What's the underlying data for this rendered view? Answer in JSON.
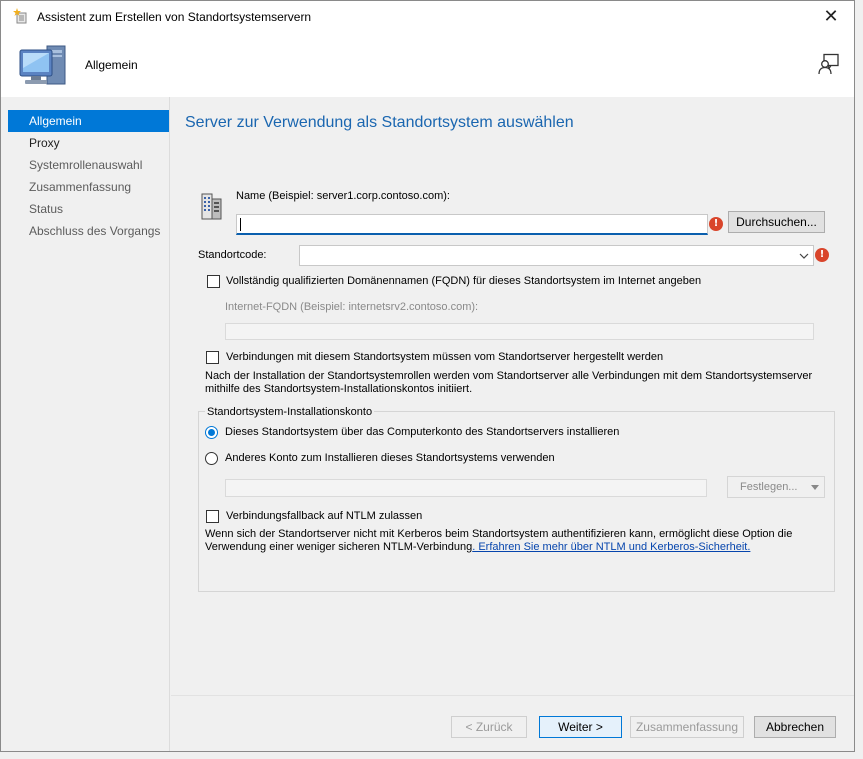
{
  "window": {
    "title": "Assistent zum Erstellen von Standortsystemservern",
    "close_glyph": "✕",
    "header_title": "Allgemein"
  },
  "sidebar": {
    "items": [
      {
        "label": "Allgemein",
        "state": "active"
      },
      {
        "label": "Proxy",
        "state": "normal"
      },
      {
        "label": "Systemrollenauswahl",
        "state": "dim"
      },
      {
        "label": "Zusammenfassung",
        "state": "dim"
      },
      {
        "label": "Status",
        "state": "dim"
      },
      {
        "label": "Abschluss des Vorgangs",
        "state": "dim"
      }
    ]
  },
  "main": {
    "heading": "Server zur Verwendung als Standortsystem auswählen",
    "name_label": "Name (Beispiel: server1.corp.contoso.com):",
    "name_value": "",
    "browse_button": "Durchsuchen...",
    "site_code_label": "Standortcode:",
    "site_code_value": "",
    "fqdn_checkbox_label": "Vollständig qualifizierten Domänennamen (FQDN) für dieses Standortsystem im Internet angeben",
    "fqdn_checked": false,
    "internet_fqdn_label": "Internet-FQDN (Beispiel: internetsrv2.contoso.com):",
    "internet_fqdn_value": "",
    "connections_checkbox_label": "Verbindungen mit diesem Standortsystem müssen vom Standortserver hergestellt werden",
    "connections_checked": false,
    "connections_note": "Nach der Installation der Standortsystemrollen werden vom Standortserver alle Verbindungen mit dem Standortsystemserver mithilfe des Standortsystem-Installationskontos initiiert.",
    "install_account_group_title": "Standortsystem-Installationskonto",
    "radio_computer_account": "Dieses Standortsystem über das Computerkonto des Standortservers installieren",
    "radio_other_account": "Anderes Konto zum Installieren dieses Standortsystems verwenden",
    "selected_radio": "computer_account",
    "account_value": "",
    "set_dropdown_label": "Festlegen...",
    "ntlm_checkbox_label": "Verbindungsfallback auf NTLM zulassen",
    "ntlm_checked": false,
    "ntlm_note": "Wenn sich der Standortserver nicht mit Kerberos beim Standortsystem authentifizieren kann, ermöglicht diese Option die Verwendung einer weniger sicheren NTLM-Verbindung",
    "ntlm_link": ". Erfahren Sie mehr über NTLM und Kerberos-Sicherheit."
  },
  "footer": {
    "back_button": "< Zurück",
    "next_button": "Weiter >",
    "summary_button": "Zusammenfassung",
    "cancel_button": "Abbrechen"
  },
  "icons": {
    "app": "wizard-star-icon",
    "header": "computer-icon",
    "feedback": "feedback-person-icon",
    "server": "server-building-icon",
    "error": "error-icon"
  },
  "colors": {
    "accent": "#0078d7",
    "heading": "#1a66b0",
    "error": "#d9452b",
    "link": "#0645ad"
  }
}
